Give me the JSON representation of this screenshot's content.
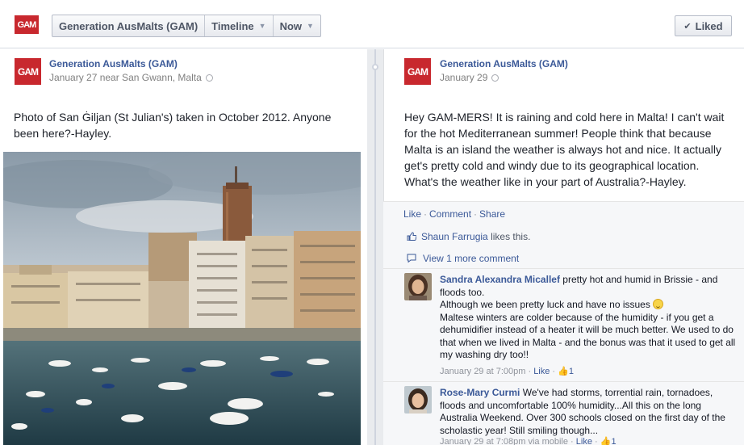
{
  "header": {
    "logo_text": "GAM",
    "breadcrumbs": [
      "Generation AusMalts (GAM)",
      "Timeline",
      "Now"
    ],
    "liked_label": "Liked"
  },
  "post_left": {
    "page_name": "Generation AusMalts (GAM)",
    "meta": "January 27 near San Gwann, Malta",
    "text": "Photo of San Ġiljan (St Julian's) taken in October 2012. Anyone been here?-Hayley.",
    "photo_icon": "harbour-photo"
  },
  "post_right": {
    "page_name": "Generation AusMalts (GAM)",
    "meta": "January 29",
    "text": "Hey GAM-MERS! It is raining and cold here in Malta! I can't wait for the hot Mediterranean summer! People think that because Malta is an island the weather is always hot and nice. It actually get's pretty cold and windy due to its geographical location. What's the weather like in your part of Australia?-Hayley.",
    "actions": [
      "Like",
      "Comment",
      "Share"
    ],
    "likes": {
      "name": "Shaun Farrugia",
      "suffix": "likes this."
    },
    "view_more": "View 1 more comment",
    "comments": [
      {
        "name": "Sandra Alexandra Micallef",
        "text1": "pretty hot and humid in Brissie - and floods too.",
        "text2": "Although we been pretty luck and have no issues",
        "text3": "Maltese winters are colder because of the humidity - if you get a dehumidifier instead of a heater it will be much better. We used to do that when we lived in Malta - and the bonus was that it used to get all my washing dry too!!",
        "time": "January 29 at 7:00pm",
        "like": "Like",
        "count": "1"
      },
      {
        "name": "Rose-Mary Curmi",
        "text1": "We've had storms, torrential rain, tornadoes, floods and uncomfortable 100% humidity...All this on the long Australia Weekend. Over 300 schools closed on the first day of the scholastic year! Still smiling though...",
        "time": "January 29 at 7:08pm via mobile",
        "like": "Like",
        "count": "1"
      }
    ]
  },
  "colors": {
    "brand": "#c8282e",
    "link": "#3b5998"
  }
}
